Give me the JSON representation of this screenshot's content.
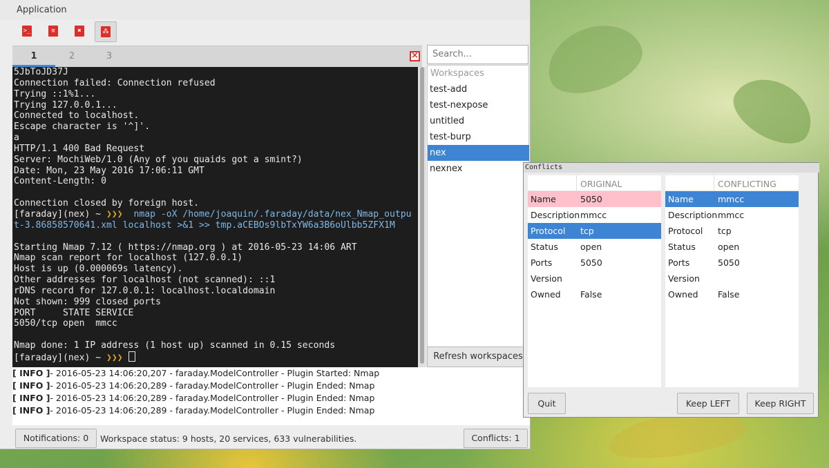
{
  "window": {
    "title": "Application"
  },
  "toolbar": {
    "icons": [
      "terminal-icon",
      "report-icon",
      "conflict-icon",
      "plugin-icon"
    ]
  },
  "terminal": {
    "tabs": [
      "1",
      "2",
      "3"
    ],
    "lines_before": [
      "5JbToJD37J",
      "Connection failed: Connection refused",
      "Trying ::1%1...",
      "Trying 127.0.0.1...",
      "Connected to localhost.",
      "Escape character is '^]'.",
      "a",
      "HTTP/1.1 400 Bad Request",
      "Server: MochiWeb/1.0 (Any of you quaids got a smint?)",
      "Date: Mon, 23 May 2016 17:06:11 GMT",
      "Content-Length: 0",
      "",
      "Connection closed by foreign host."
    ],
    "prompt": "[faraday](nex) ~ ",
    "arrows": "❯❯❯",
    "command_1": "nmap -oX /home/joaquin/.faraday/data/nex_Nmap_outpu",
    "command_2": "t-3.86858570641.xml localhost >&1 >> tmp.aCEBOs9lbTxYW6a3B6oUlbb5ZFX1M",
    "lines_after": [
      "",
      "Starting Nmap 7.12 ( https://nmap.org ) at 2016-05-23 14:06 ART",
      "Nmap scan report for localhost (127.0.0.1)",
      "Host is up (0.000069s latency).",
      "Other addresses for localhost (not scanned): ::1",
      "rDNS record for 127.0.0.1: localhost.localdomain",
      "Not shown: 999 closed ports",
      "PORT     STATE SERVICE",
      "5050/tcp open  mmcc",
      "",
      "Nmap done: 1 IP address (1 host up) scanned in 0.15 seconds"
    ]
  },
  "workspaces": {
    "search_placeholder": "Search...",
    "header": "Workspaces",
    "items": [
      "test-add",
      "test-nexpose",
      "untitled",
      "test-burp",
      "nex",
      "nexnex"
    ],
    "selected": "nex",
    "refresh_label": "Refresh workspaces"
  },
  "log": [
    {
      "tag": "[ INFO ]",
      "text": "- 2016-05-23 14:06:20,207 - faraday.ModelController - Plugin Started: Nmap"
    },
    {
      "tag": "[ INFO ]",
      "text": "- 2016-05-23 14:06:20,289 - faraday.ModelController - Plugin Ended: Nmap"
    },
    {
      "tag": "[ INFO ]",
      "text": "- 2016-05-23 14:06:20,289 - faraday.ModelController - Plugin Ended: Nmap"
    },
    {
      "tag": "[ INFO ]",
      "text": "- 2016-05-23 14:06:20,289 - faraday.ModelController - Plugin Ended: Nmap"
    }
  ],
  "statusbar": {
    "notifications": "Notifications: 0",
    "workspace_status": "Workspace status: 9 hosts, 20 services, 633 vulnerabilities.",
    "conflicts": "Conflicts: 1"
  },
  "conflicts_dialog": {
    "title": "Conflicts",
    "original_header": "ORIGINAL",
    "conflicting_header": "CONFLICTING",
    "original_rows": [
      {
        "key": "Name",
        "value": "5050"
      },
      {
        "key": "Description",
        "value": "mmcc"
      },
      {
        "key": "Protocol",
        "value": "tcp"
      },
      {
        "key": "Status",
        "value": "open"
      },
      {
        "key": "Ports",
        "value": "5050"
      },
      {
        "key": "Version",
        "value": ""
      },
      {
        "key": "Owned",
        "value": "False"
      }
    ],
    "conflicting_rows": [
      {
        "key": "Name",
        "value": "mmcc"
      },
      {
        "key": "Description",
        "value": "mmcc"
      },
      {
        "key": "Protocol",
        "value": "tcp"
      },
      {
        "key": "Status",
        "value": "open"
      },
      {
        "key": "Ports",
        "value": "5050"
      },
      {
        "key": "Version",
        "value": ""
      },
      {
        "key": "Owned",
        "value": "False"
      }
    ],
    "quit_label": "Quit",
    "keep_left_label": "Keep LEFT",
    "keep_right_label": "Keep RIGHT",
    "colors": {
      "conflict_row": "#ffc0cb",
      "selected_row": "#3d85d4"
    }
  }
}
